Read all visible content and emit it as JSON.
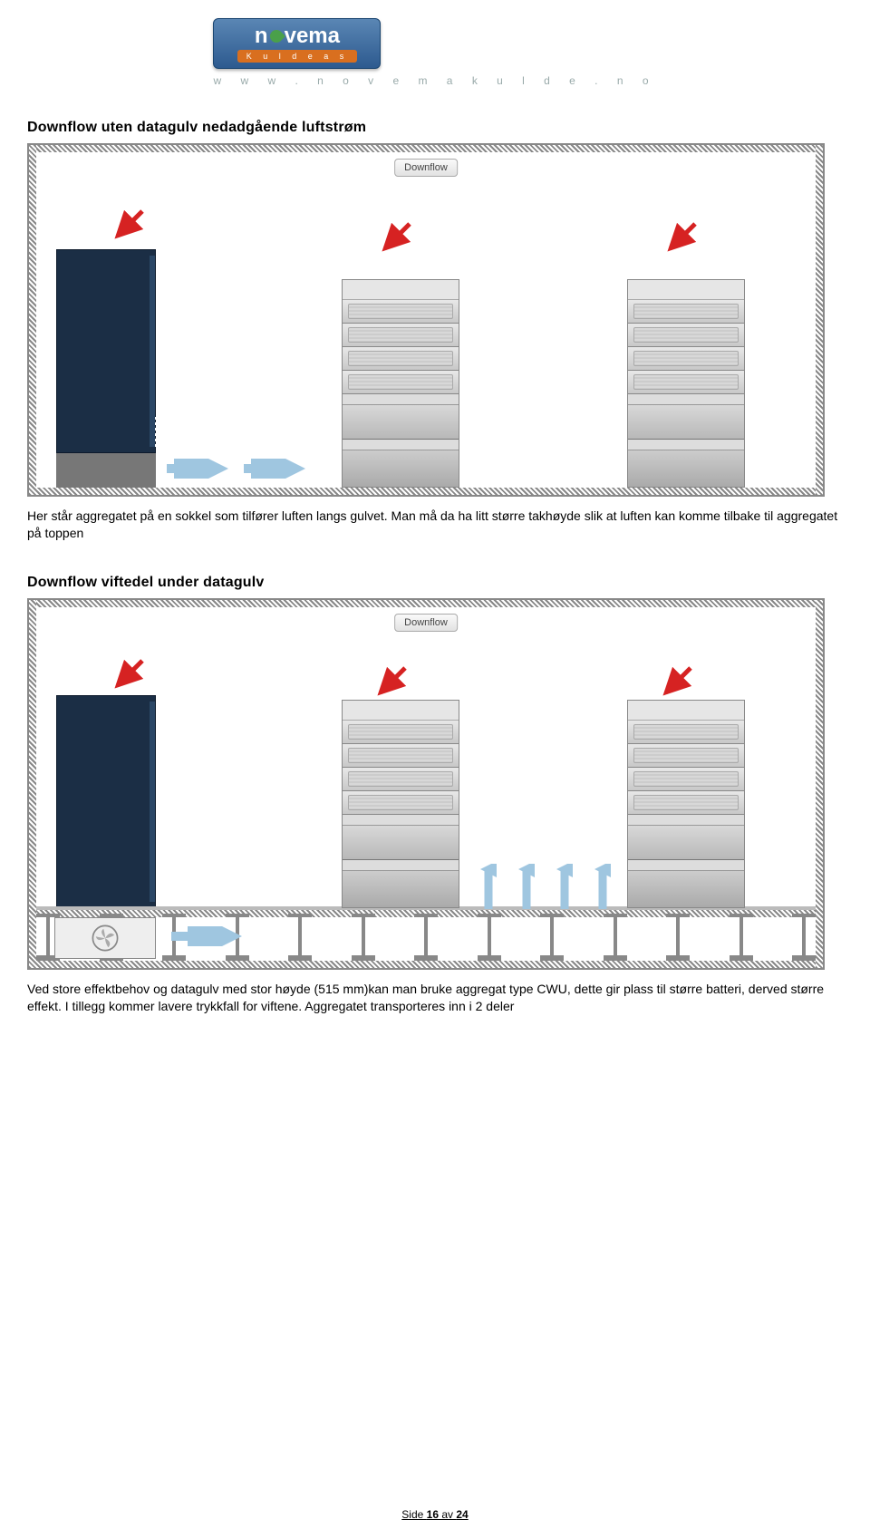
{
  "logo": {
    "brand_prefix": "n",
    "brand_suffix": "vema",
    "subtitle": "K u l d e a s",
    "url": "w w w . n o v e m a k u l d e . n o"
  },
  "diagram_label": "Downflow",
  "section1": {
    "heading": "Downflow  uten datagulv nedadgående luftstrøm",
    "caption": "Her står aggregatet på en sokkel som tilfører luften langs gulvet. Man må da ha litt større takhøyde slik at luften kan komme tilbake til aggregatet på toppen"
  },
  "section2": {
    "heading": "Downflow viftedel under datagulv",
    "caption": "Ved store effektbehov og datagulv med stor høyde (515 mm)kan man bruke aggregat type CWU, dette gir plass til større batteri, derved større effekt. I tillegg kommer lavere trykkfall for viftene. Aggregatet transporteres inn i 2 deler"
  },
  "footer": {
    "prefix": "Side ",
    "page": "16",
    "mid": " av ",
    "total": "24"
  }
}
